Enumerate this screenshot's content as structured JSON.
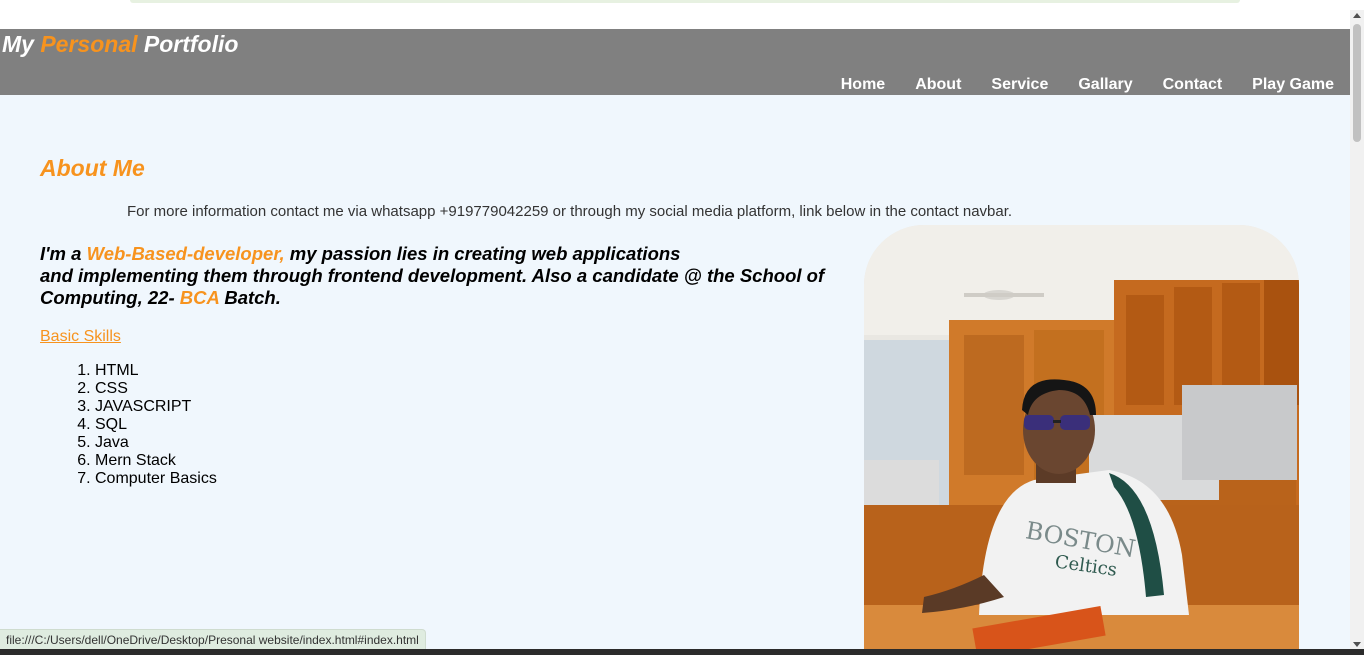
{
  "header": {
    "logo": {
      "part1": "My ",
      "part2": "Personal",
      "part3": " Portfolio"
    },
    "nav": [
      "Home",
      "About",
      "Service",
      "Gallary",
      "Contact",
      "Play Game"
    ]
  },
  "about": {
    "title": "About Me",
    "contact_note": "For more information contact me via whatsapp +919779042259 or through my social media platform, link below in the contact navbar.",
    "intro": {
      "t1": "I'm a ",
      "h1": "Web-Based-developer,",
      "t2": " my passion lies in creating web applications",
      "t3": "and implementing them through frontend development. Also a candidate @ the School of Computing, 22- ",
      "h2": "BCA",
      "t4": " Batch."
    },
    "skills_link": "Basic Skills",
    "skills": [
      "HTML",
      "CSS",
      "JAVASCRIPT",
      "SQL",
      "Java",
      "Mern Stack",
      "Computer Basics"
    ]
  },
  "status_bar": "file:///C:/Users/dell/OneDrive/Desktop/Presonal website/index.html#index.html",
  "colors": {
    "accent": "#f7931e",
    "header_bg": "#808080",
    "page_bg": "#f0f7fd"
  }
}
